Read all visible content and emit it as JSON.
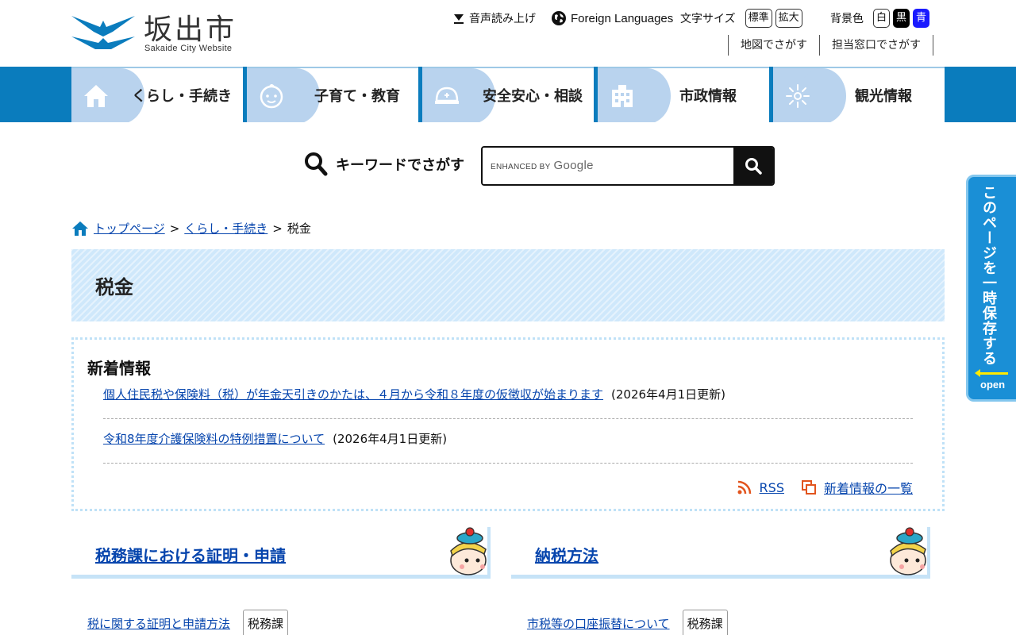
{
  "header": {
    "logo_name": "坂出市",
    "logo_sub": "Sakaide City Website",
    "voice_label": "音声読み上げ",
    "foreign_label": "Foreign Languages",
    "fontsize_label": "文字サイズ",
    "fontsize_options": [
      "標準",
      "拡大"
    ],
    "bgcolor_label": "背景色",
    "bgcolor_options": [
      "白",
      "黒",
      "青"
    ],
    "sublinks": [
      "地図でさがす",
      "担当窓口でさがす"
    ]
  },
  "gnav": {
    "items": [
      {
        "label": "くらし・手続き",
        "icon": "house-icon"
      },
      {
        "label": "子育て・教育",
        "icon": "baby-icon"
      },
      {
        "label": "安全安心・相談",
        "icon": "helmet-icon"
      },
      {
        "label": "市政情報",
        "icon": "building-icon"
      },
      {
        "label": "観光情報",
        "icon": "firework-icon"
      }
    ]
  },
  "search": {
    "label": "キーワードでさがす",
    "enhanced_by": "ENHANCED BY",
    "google": "Google"
  },
  "breadcrumb": {
    "items": [
      "トップページ",
      "くらし・手続き"
    ],
    "current": "税金",
    "separator": ">"
  },
  "page": {
    "title": "税金"
  },
  "news": {
    "title": "新着情報",
    "items": [
      {
        "text": "個人住民税や保険料（税）が年金天引きのかたは、４月から令和８年度の仮徴収が始まります",
        "date": "(2026年4月1日更新)"
      },
      {
        "text": "令和8年度介護保険料の特例措置について",
        "date": "(2026年4月1日更新)"
      }
    ],
    "rss_label": "RSS",
    "list_label": "新着情報の一覧"
  },
  "categories": [
    {
      "title": "税務課における証明・申請",
      "link": "税に関する証明と申請方法",
      "tag": "税務課"
    },
    {
      "title": "納税方法",
      "link": "市税等の口座振替について",
      "tag": "税務課"
    }
  ],
  "save_tab": {
    "text": "このページを一時保存する",
    "open": "open"
  },
  "colors": {
    "brand_blue": "#0a7cbd",
    "nav_icon_bg": "#b9d3ee",
    "title_bg": "#cfe8fb",
    "link": "#0645ad",
    "save_tab": "#1a8fd6"
  }
}
